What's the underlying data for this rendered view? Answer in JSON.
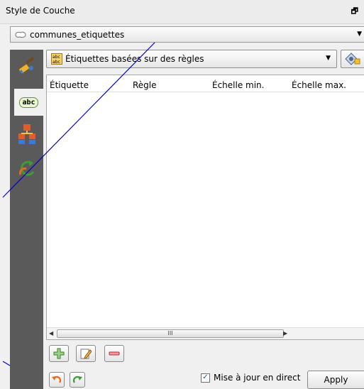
{
  "panel": {
    "title": "Style de Couche",
    "float_glyph": "🗗"
  },
  "layer_selector": {
    "value": "communes_etiquettes"
  },
  "sidebar": {
    "items": [
      {
        "icon": "paintbrush-icon"
      },
      {
        "icon": "label-abc-icon",
        "label": "abc"
      },
      {
        "icon": "diagram-icon"
      },
      {
        "icon": "history-undo-icon"
      }
    ]
  },
  "labeling": {
    "mode_value": "Étiquettes basées sur des règles",
    "tool_icon": "expression-settings-icon"
  },
  "rules_table": {
    "columns": [
      "Étiquette",
      "Règle",
      "Échelle min.",
      "Échelle max."
    ],
    "rows": [],
    "scroll_grip": "III"
  },
  "rule_buttons": {
    "add": "add-rule-icon",
    "edit": "edit-rule-icon",
    "remove": "remove-rule-icon"
  },
  "footer": {
    "live_update_label": "Mise à jour en direct",
    "live_update_checked": true,
    "apply_label": "Apply",
    "check_mark": "✓"
  },
  "colors": {
    "sidebar_bg": "#5a5a5a",
    "annotation_line": "#0000cc"
  }
}
